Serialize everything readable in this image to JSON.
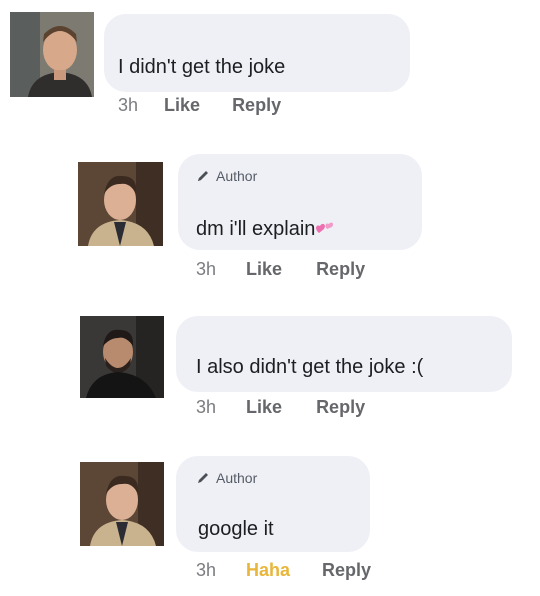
{
  "comments": [
    {
      "avatar": "user-avatar-man-dark-jacket",
      "author_badge": "",
      "text": "I didn't get the joke",
      "time": "3h",
      "actions": [
        "Like",
        "Reply"
      ]
    },
    {
      "avatar": "user-avatar-man-trench-coat",
      "author_badge": "Author",
      "text": "dm i'll explain",
      "emoji": "pink-hearts-emoji",
      "time": "3h",
      "actions": [
        "Like",
        "Reply"
      ]
    },
    {
      "avatar": "user-avatar-bearded-man-dark",
      "author_badge": "",
      "text": "I also didn't get the joke :(",
      "time": "3h",
      "actions": [
        "Like",
        "Reply"
      ]
    },
    {
      "avatar": "user-avatar-man-trench-coat",
      "author_badge": "Author",
      "text": "google it",
      "time": "3h",
      "actions": [
        "Haha",
        "Reply"
      ]
    }
  ],
  "colors": {
    "bubble": "#eff0f5",
    "haha_reaction": "#e7b63a",
    "action_text": "#65676b"
  }
}
